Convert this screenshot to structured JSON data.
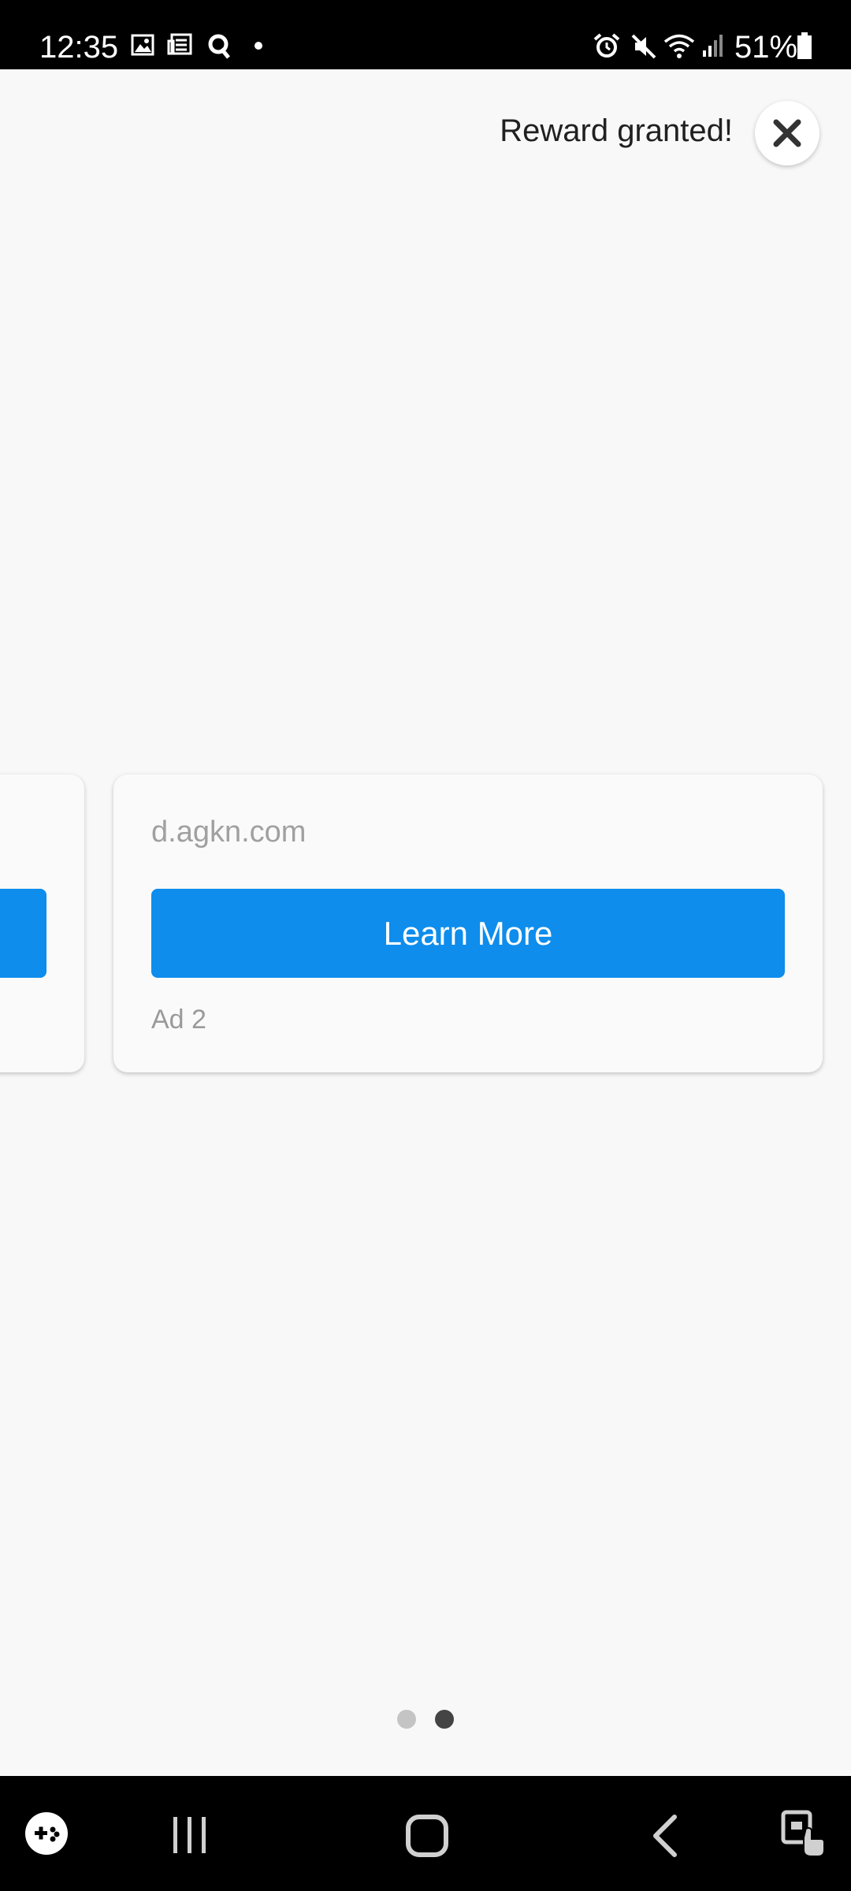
{
  "status_bar": {
    "time": "12:35",
    "battery": "51%",
    "icons_left": [
      "gallery-icon",
      "news-icon",
      "q-icon",
      "dot-icon"
    ],
    "icons_right": [
      "alarm-icon",
      "mute-icon",
      "wifi-icon",
      "signal-icon",
      "battery-icon"
    ]
  },
  "header": {
    "reward_text": "Reward granted!",
    "close_icon": "close-icon"
  },
  "ads": [
    {
      "domain": "",
      "cta": "",
      "label": ""
    },
    {
      "domain": "d.agkn.com",
      "cta": "Learn More",
      "label": "Ad 2"
    }
  ],
  "pager": {
    "count": 2,
    "active": 2
  },
  "nav_bar": {
    "items": [
      "game-launcher-icon",
      "recents-icon",
      "home-icon",
      "back-icon",
      "accessibility-icon"
    ]
  },
  "colors": {
    "cta": "#0e8dec",
    "background": "#f8f8f8",
    "dot_active": "#444444",
    "dot_inactive": "#c4c4c4"
  }
}
